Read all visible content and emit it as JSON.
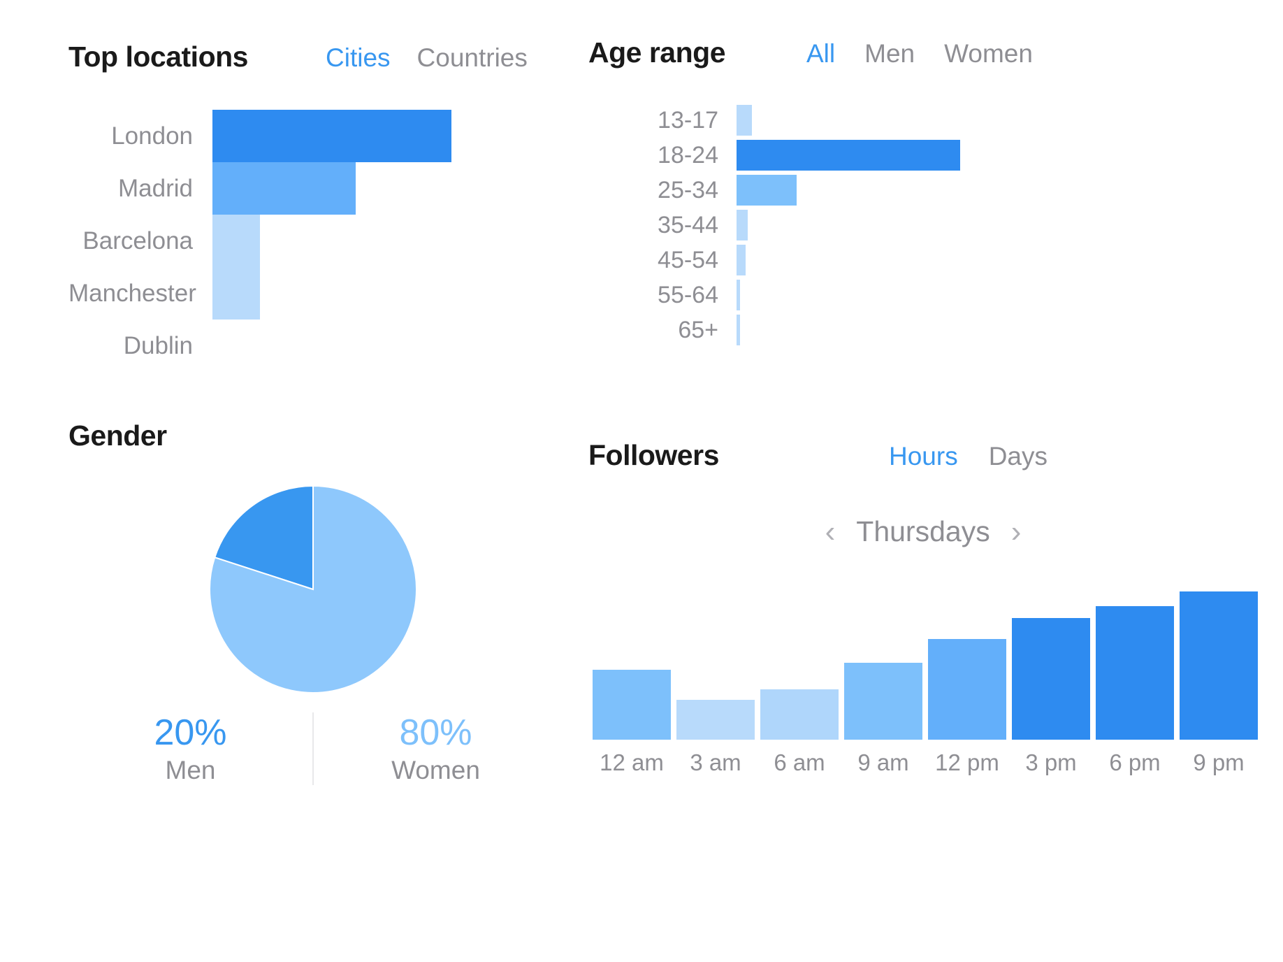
{
  "top_locations": {
    "title": "Top locations",
    "tabs": [
      {
        "label": "Cities",
        "active": true
      },
      {
        "label": "Countries",
        "active": false
      }
    ]
  },
  "age_range": {
    "title": "Age range",
    "tabs": [
      {
        "label": "All",
        "active": true
      },
      {
        "label": "Men",
        "active": false
      },
      {
        "label": "Women",
        "active": false
      }
    ]
  },
  "gender": {
    "title": "Gender",
    "men_pct": "20%",
    "men_label": "Men",
    "women_pct": "80%",
    "women_label": "Women"
  },
  "followers": {
    "title": "Followers",
    "tabs": [
      {
        "label": "Hours",
        "active": true
      },
      {
        "label": "Days",
        "active": false
      }
    ],
    "day_prev_icon": "chevron-left",
    "day_next_icon": "chevron-right",
    "day_label": "Thursdays"
  },
  "colors": {
    "accent": "#3897f0",
    "bar_dark": "#2e8bf0",
    "bar_mid": "#63affa",
    "bar_light": "#b8dafb",
    "bar_pale": "#cfe5fc",
    "muted_text": "#8e8e93",
    "title_text": "#1a1a1a",
    "divider": "#e8e8ea"
  },
  "chart_data": [
    {
      "type": "bar",
      "title": "Top locations",
      "orientation": "horizontal",
      "categories": [
        "London",
        "Madrid",
        "Barcelona",
        "Manchester",
        "Dublin"
      ],
      "values": [
        100,
        60,
        20,
        20,
        0
      ],
      "colors": [
        "#2e8bf0",
        "#63affa",
        "#b8dafb",
        "#b8dafb",
        "#b8dafb"
      ],
      "xlabel": "",
      "ylabel": "",
      "xlim": [
        0,
        100
      ],
      "grid": false,
      "legend": "none"
    },
    {
      "type": "bar",
      "title": "Age range",
      "orientation": "horizontal",
      "categories": [
        "13-17",
        "18-24",
        "25-34",
        "35-44",
        "45-54",
        "55-64",
        "65+"
      ],
      "values": [
        7,
        100,
        27,
        5,
        4,
        1,
        1
      ],
      "colors": [
        "#b8dafb",
        "#2e8bf0",
        "#7dc0fb",
        "#b8dafb",
        "#b8dafb",
        "#b8dafb",
        "#b8dafb"
      ],
      "xlabel": "",
      "ylabel": "",
      "xlim": [
        0,
        100
      ],
      "grid": false,
      "legend": "none"
    },
    {
      "type": "pie",
      "title": "Gender",
      "labels": [
        "Men",
        "Women"
      ],
      "values": [
        20,
        80
      ],
      "colors": [
        "#3897f0",
        "#8ec8fc"
      ],
      "start_angle": 90,
      "direction": "counterclockwise",
      "legend": "bottom"
    },
    {
      "type": "bar",
      "title": "Followers",
      "subtitle": "Thursdays",
      "orientation": "vertical",
      "categories": [
        "12 am",
        "3 am",
        "6 am",
        "9 am",
        "12 pm",
        "3 pm",
        "6 pm",
        "9 pm"
      ],
      "values": [
        47,
        27,
        34,
        52,
        68,
        82,
        90,
        100
      ],
      "colors": [
        "#7dc0fb",
        "#b8dafb",
        "#afd6fb",
        "#7dc0fb",
        "#63affa",
        "#2e8bf0",
        "#2e8bf0",
        "#2e8bf0"
      ],
      "xlabel": "",
      "ylabel": "",
      "ylim": [
        0,
        100
      ],
      "grid": false,
      "legend": "none"
    }
  ]
}
